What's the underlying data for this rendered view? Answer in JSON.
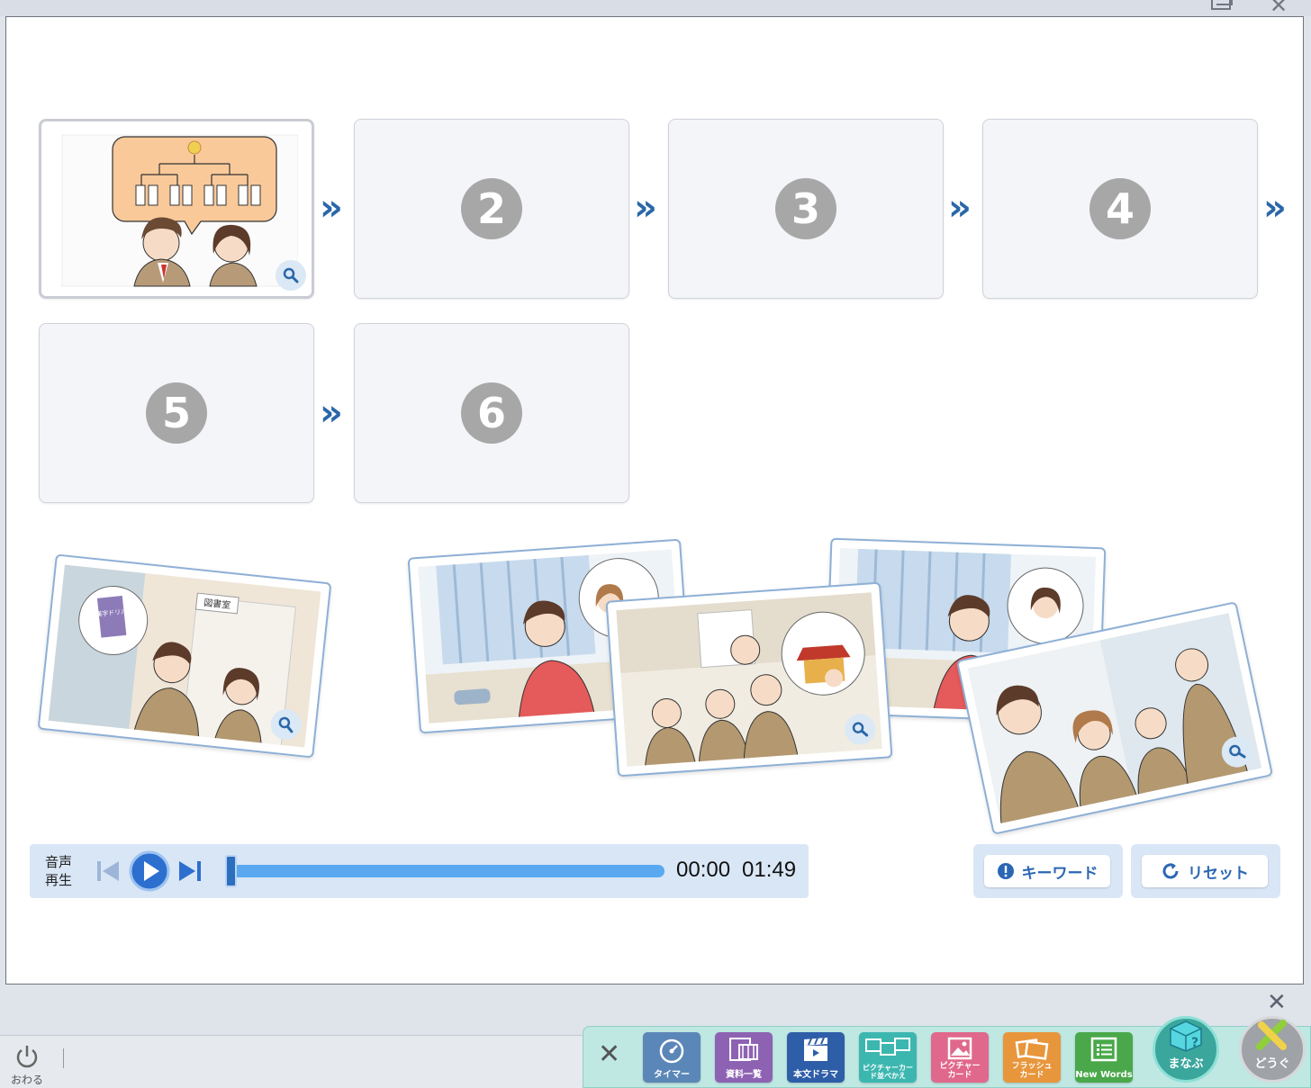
{
  "window": {
    "restore_label": "",
    "close_label": "✕"
  },
  "sequence": {
    "slots": [
      {
        "number": "",
        "filled": true
      },
      {
        "number": "2"
      },
      {
        "number": "3"
      },
      {
        "number": "4"
      },
      {
        "number": "5"
      },
      {
        "number": "6"
      }
    ],
    "arrow": "»",
    "scene_sign": "図書室",
    "book_title": "漢字ドリル"
  },
  "audio": {
    "label": "音声再生",
    "current_time": "00:00",
    "total_time": "01:49"
  },
  "buttons": {
    "keyword": "キーワード",
    "reset": "リセット"
  },
  "dock": {
    "close_label": "✕",
    "power_label": "おわる",
    "tools": [
      {
        "label": "タイマー",
        "icon": "timer-icon",
        "color": "#5b86b8"
      },
      {
        "label": "資料一覧",
        "icon": "film-icon",
        "color": "#8e62b3"
      },
      {
        "label": "本文ドラマ",
        "icon": "clapper-icon",
        "color": "#2e5ea8"
      },
      {
        "label": "ピクチャーカード並べかえ",
        "icon": "cards-icon",
        "color": "#3cb7b0"
      },
      {
        "label": "ピクチャーカード",
        "icon": "picture-icon",
        "color": "#e0688c"
      },
      {
        "label": "フラッシュカード",
        "icon": "flash-icon",
        "color": "#e8963c"
      },
      {
        "label": "New Words",
        "icon": "list-icon",
        "color": "#4aa84a"
      }
    ],
    "manabu_label": "まなぶ",
    "dougu_label": "どうぐ"
  }
}
